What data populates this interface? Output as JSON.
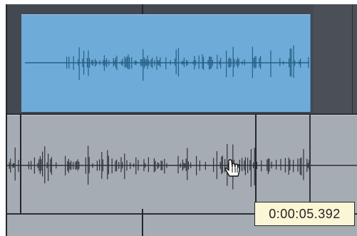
{
  "timeline": {
    "cursor_icon": "hand-pointer-icon",
    "tooltip_time": "0:00:05.392"
  },
  "colors": {
    "clip_fill": "#6fabd8",
    "waveform_clip": "#275f86",
    "waveform_track": "#2f3338",
    "track_bg": "#a6acb3",
    "tooltip_bg": "#fbf6d5"
  }
}
